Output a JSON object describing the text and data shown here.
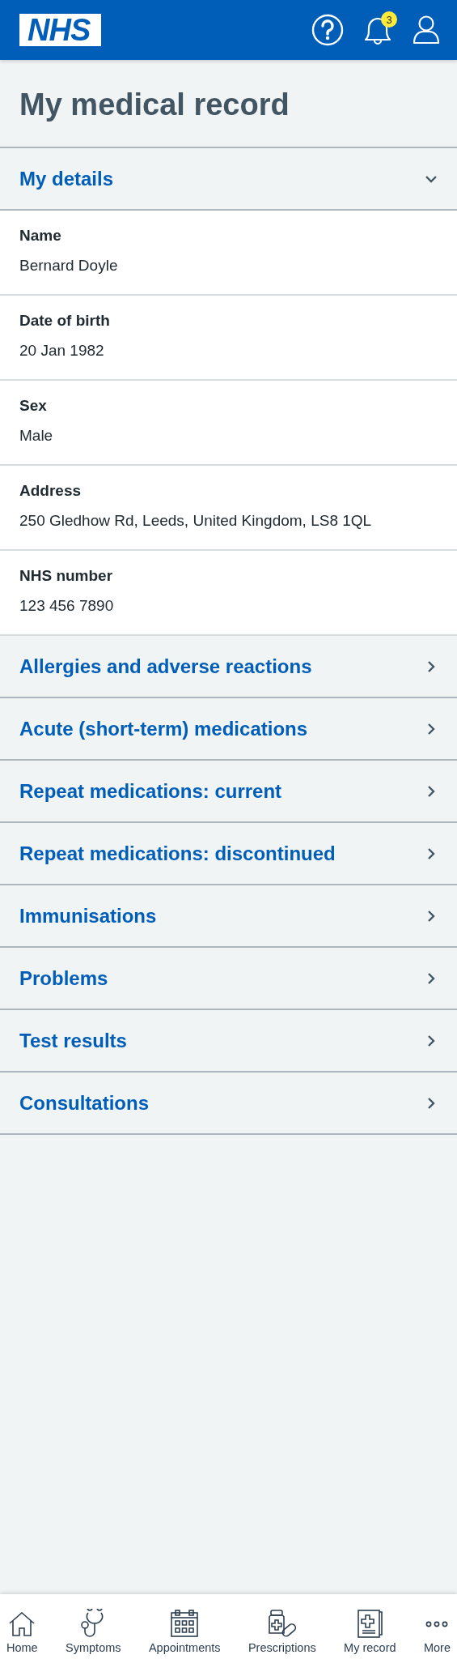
{
  "header": {
    "logo": "NHS",
    "notifications": "3"
  },
  "title": "My medical record",
  "details": {
    "heading": "My details",
    "expanded": true,
    "fields": [
      {
        "label": "Name",
        "value": "Bernard Doyle"
      },
      {
        "label": "Date of birth",
        "value": "20 Jan 1982"
      },
      {
        "label": "Sex",
        "value": "Male"
      },
      {
        "label": "Address",
        "value": "250 Gledhow Rd, Leeds, United Kingdom, LS8 1QL"
      },
      {
        "label": "NHS number",
        "value": "123 456 7890"
      }
    ]
  },
  "sections": [
    {
      "label": "Allergies and adverse reactions",
      "expanded": false
    },
    {
      "label": "Acute (short-term) medications",
      "expanded": false
    },
    {
      "label": "Repeat medications: current",
      "expanded": false
    },
    {
      "label": "Repeat medications: discontinued",
      "expanded": false
    },
    {
      "label": "Immunisations",
      "expanded": false
    },
    {
      "label": "Problems",
      "expanded": false
    },
    {
      "label": "Test results",
      "expanded": false
    },
    {
      "label": "Consultations",
      "expanded": false
    }
  ],
  "nav": [
    {
      "kind": "home",
      "label": "Home"
    },
    {
      "kind": "symptoms",
      "label": "Symptoms"
    },
    {
      "kind": "appointments",
      "label": "Appointments"
    },
    {
      "kind": "prescriptions",
      "label": "Prescriptions"
    },
    {
      "kind": "record",
      "label": "My record"
    },
    {
      "kind": "more",
      "label": "More"
    }
  ]
}
